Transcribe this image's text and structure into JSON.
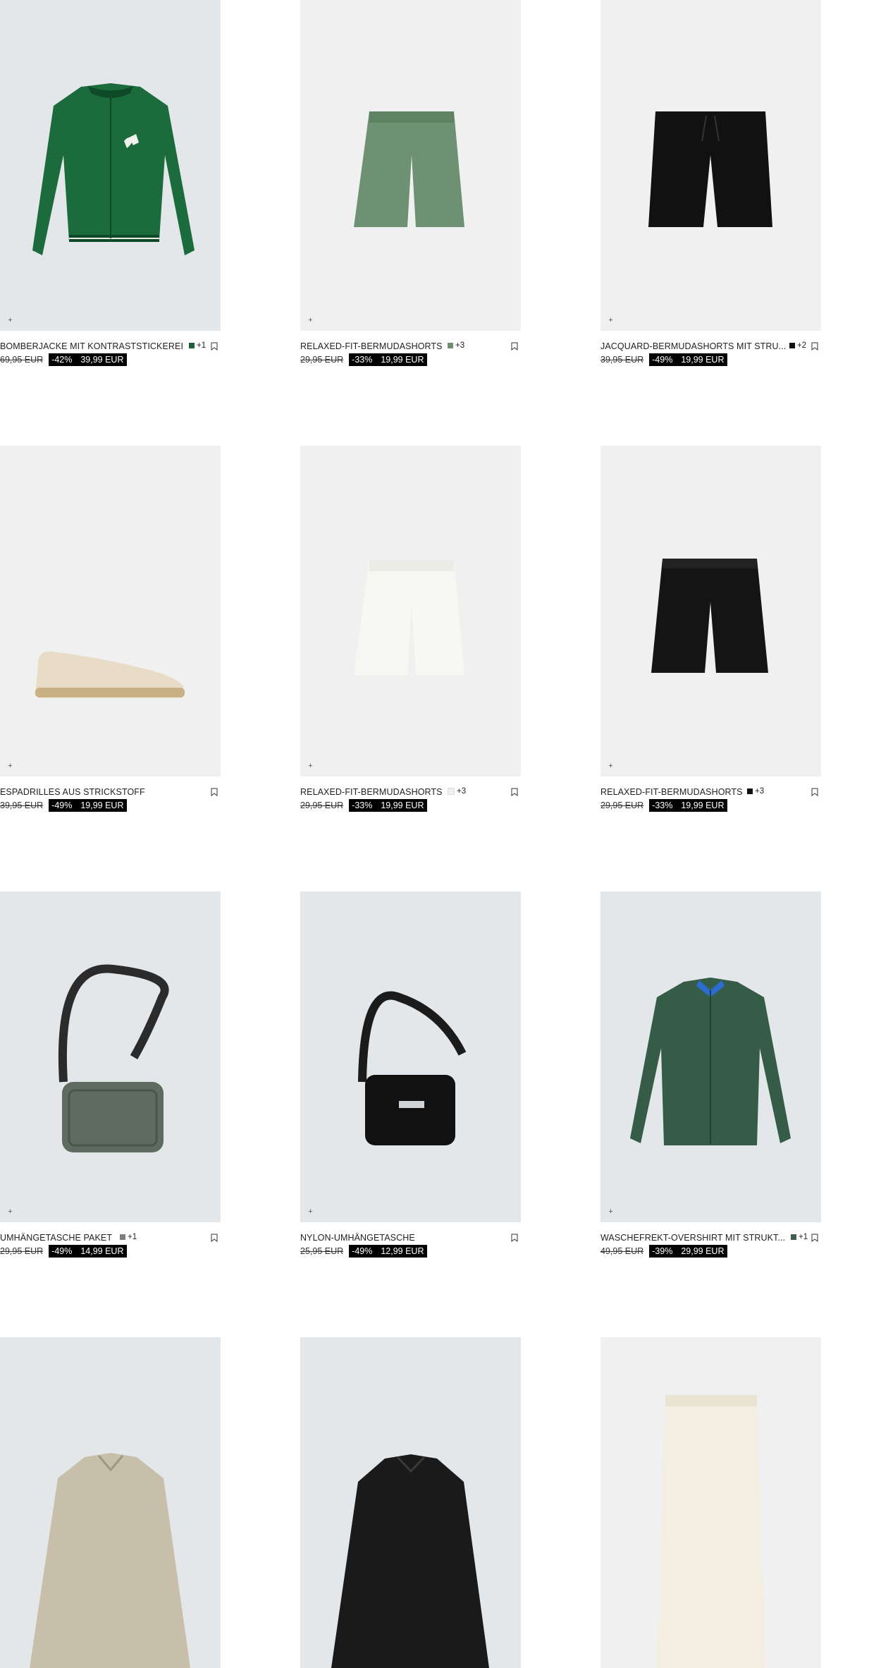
{
  "icons": {
    "add": "plus-icon",
    "bookmark": "bookmark-icon"
  },
  "products": [
    {
      "name": "BOMBERJACKE MIT KONTRASTSTICKEREI",
      "swatch": "#1f5e3b",
      "more": "+1",
      "old": "69,95 EUR",
      "disc": "-42%",
      "price": "39,99 EUR"
    },
    {
      "name": "RELAXED-FIT-BERMUDASHORTS",
      "swatch": "#6f8e6e",
      "more": "+3",
      "old": "29,95 EUR",
      "disc": "-33%",
      "price": "19,99 EUR"
    },
    {
      "name": "JACQUARD-BERMUDASHORTS MIT STRU...",
      "swatch": "#111111",
      "more": "+2",
      "old": "39,95 EUR",
      "disc": "-49%",
      "price": "19,99 EUR"
    },
    {
      "name": "ESPADRILLES AUS STRICKSTOFF",
      "swatch": "",
      "more": "",
      "old": "39,95 EUR",
      "disc": "-49%",
      "price": "19,99 EUR"
    },
    {
      "name": "RELAXED-FIT-BERMUDASHORTS",
      "swatch": "#f1f0ec",
      "more": "+3",
      "old": "29,95 EUR",
      "disc": "-33%",
      "price": "19,99 EUR"
    },
    {
      "name": "RELAXED-FIT-BERMUDASHORTS",
      "swatch": "#111111",
      "more": "+3",
      "old": "29,95 EUR",
      "disc": "-33%",
      "price": "19,99 EUR"
    },
    {
      "name": "UMHÄNGETASCHE PAKET",
      "swatch": "#7a7f7a",
      "more": "+1",
      "old": "29,95 EUR",
      "disc": "-49%",
      "price": "14,99 EUR"
    },
    {
      "name": "NYLON-UMHÄNGETASCHE",
      "swatch": "",
      "more": "",
      "old": "25,95 EUR",
      "disc": "-49%",
      "price": "12,99 EUR"
    },
    {
      "name": "WASCHEFREKT-OVERSHIRT MIT STRUKT...",
      "swatch": "#3e5e4b",
      "more": "+1",
      "old": "49,95 EUR",
      "disc": "-39%",
      "price": "29,99 EUR"
    },
    {
      "name": "",
      "swatch": "",
      "more": "",
      "old": "",
      "disc": "",
      "price": ""
    },
    {
      "name": "",
      "swatch": "",
      "more": "",
      "old": "",
      "disc": "",
      "price": ""
    },
    {
      "name": "",
      "swatch": "",
      "more": "",
      "old": "",
      "disc": "",
      "price": ""
    }
  ]
}
